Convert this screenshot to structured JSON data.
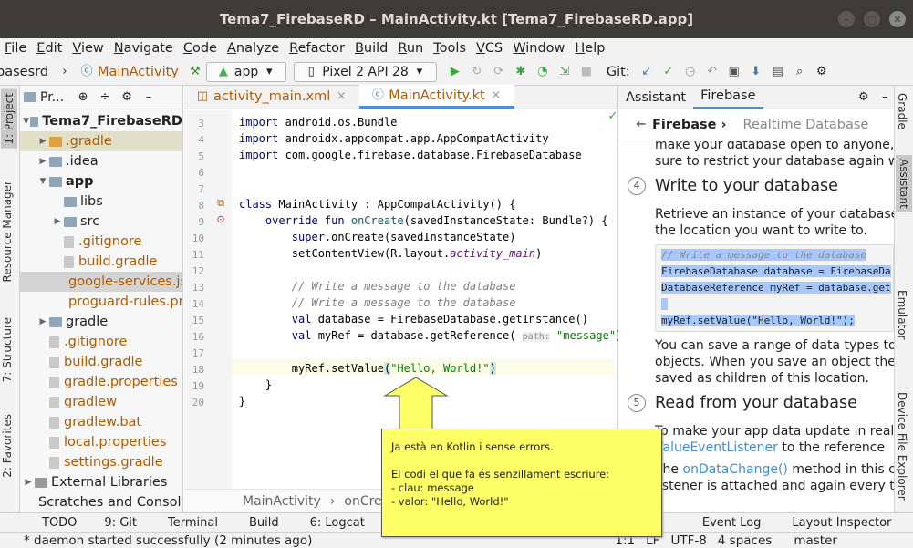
{
  "window": {
    "title": "Tema7_FirebaseRD – MainActivity.kt [Tema7_FirebaseRD.app]"
  },
  "menu": [
    "File",
    "Edit",
    "View",
    "Navigate",
    "Code",
    "Analyze",
    "Refactor",
    "Build",
    "Run",
    "Tools",
    "VCS",
    "Window",
    "Help"
  ],
  "toolbar": {
    "breadcrumb_project": "basesrd",
    "breadcrumb_file": "MainActivity",
    "run_config": "app",
    "device": "Pixel 2 API 28",
    "git_label": "Git:"
  },
  "left_tabs": {
    "project": "1: Project",
    "resource_manager": "Resource Manager",
    "structure": "7: Structure",
    "favorites": "2: Favorites"
  },
  "right_tabs": {
    "gradle": "Gradle",
    "assistant": "Assistant",
    "emulator": "Emulator",
    "device_file_explorer": "Device File Explorer"
  },
  "project_panel": {
    "header": "Pr...",
    "tree": [
      {
        "label": "Tema7_FirebaseRD",
        "bold": true
      },
      {
        "label": ".gradle"
      },
      {
        "label": ".idea"
      },
      {
        "label": "app",
        "bold": true
      },
      {
        "label": "libs"
      },
      {
        "label": "src"
      },
      {
        "label": ".gitignore"
      },
      {
        "label": "build.gradle"
      },
      {
        "label": "google-services.json"
      },
      {
        "label": "proguard-rules.pro"
      },
      {
        "label": "gradle"
      },
      {
        "label": ".gitignore"
      },
      {
        "label": "build.gradle"
      },
      {
        "label": "gradle.properties"
      },
      {
        "label": "gradlew"
      },
      {
        "label": "gradlew.bat"
      },
      {
        "label": "local.properties"
      },
      {
        "label": "settings.gradle"
      },
      {
        "label": "External Libraries"
      },
      {
        "label": "Scratches and Consoles"
      }
    ]
  },
  "editor": {
    "tabs": [
      {
        "label": "activity_main.xml"
      },
      {
        "label": "MainActivity.kt"
      }
    ],
    "breadcrumb": [
      "MainActivity",
      "onCre"
    ],
    "param_hint": "path:"
  },
  "assistant": {
    "tabs": [
      "Assistant",
      "Firebase"
    ],
    "nav_back": "Firebase ›",
    "nav_current": "Realtime Database",
    "intro1": "make your database open to anyone, e",
    "intro2": "sure to restrict your database again wh",
    "step4_num": "4",
    "step4_title": "Write to your database",
    "step4_p1": "Retrieve an instance of your database (",
    "step4_p2": "the location you want to write to.",
    "code_comment": "// Write a message to the database",
    "code_l2": "FirebaseDatabase database = FirebaseDa",
    "code_l3": "DatabaseReference myRef = database.get",
    "code_l5": "myRef.setValue(\"Hello, World!\");",
    "step4_p3": "You can save a range of data types to t",
    "step4_p4": "objects. When you save an object the r",
    "step4_p5": "saved as children of this location.",
    "step5_num": "5",
    "step5_title": "Read from your database",
    "step5_p1": "To make your app data update in realti",
    "step5_p2_link": "ValueEventListener",
    "step5_p2_rest": " to the reference",
    "step5_p3_pre": "The ",
    "step5_p3_link": "onDataChange()",
    "step5_p3_rest": " method in this c",
    "step5_p4": "listener is attached and again every tim"
  },
  "bottom_tools": [
    "TODO",
    "9: Git",
    "Terminal",
    "Build",
    "6: Logcat",
    "Event Log",
    "Layout Inspector"
  ],
  "status": {
    "message": "* daemon started successfully (2 minutes ago)",
    "position": "1:1",
    "line_sep": "LF",
    "encoding": "UTF-8",
    "indent": "4 spaces",
    "branch": "master"
  },
  "callout": {
    "line1": "Ja està en Kotlin i sense errors.",
    "line2": "El codi el que fa és senzillament escriure:",
    "line3": "- clau: message",
    "line4": "- valor: \"Hello, World!\""
  }
}
